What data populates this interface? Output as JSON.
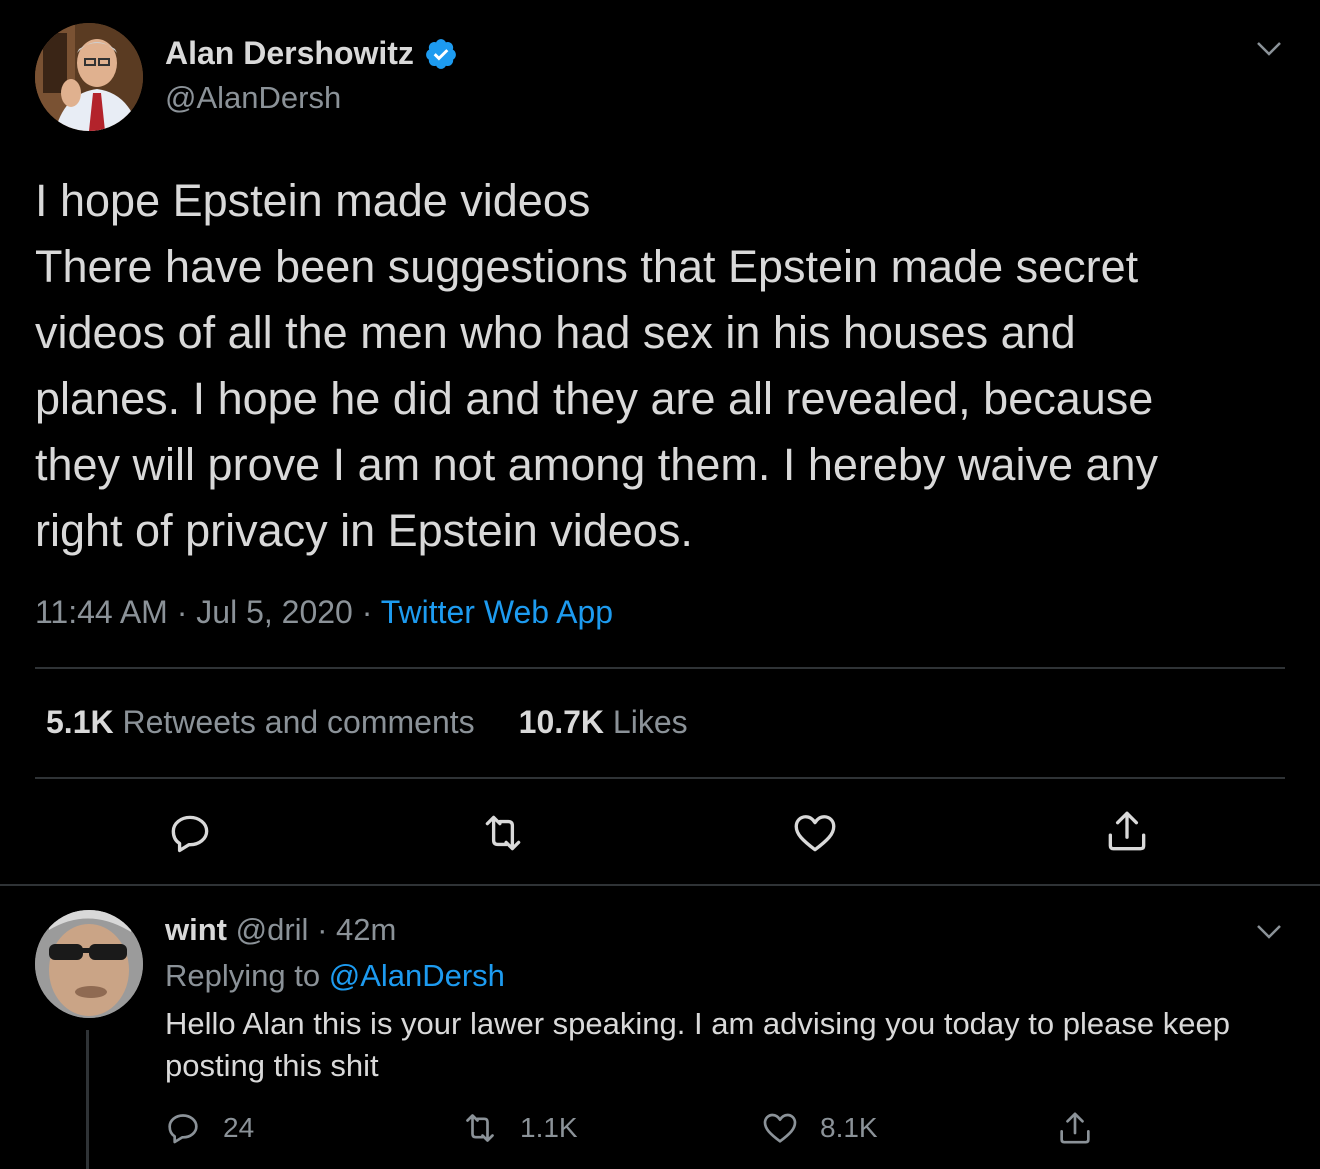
{
  "colors": {
    "background": "#000000",
    "text": "#d9d9d9",
    "muted": "#8b9298",
    "accent": "#1d9bf0",
    "divider": "#2f3336"
  },
  "tweet": {
    "display_name": "Alan Dershowitz",
    "handle": "@AlanDersh",
    "verified_icon": "verified-badge-icon",
    "text_lines": [
      "I hope Epstein made videos",
      "There have been suggestions that Epstein made secret",
      "videos of all the men who had sex in his houses and",
      "planes. I hope he did and they are all revealed, because",
      "they will prove I am not among them. I hereby waive any",
      "right of privacy in Epstein videos."
    ],
    "time": "11:44 AM",
    "date": "Jul 5, 2020",
    "separator": "·",
    "source": "Twitter Web App",
    "retweets_count": "5.1K",
    "retweets_label": "Retweets and comments",
    "likes_count": "10.7K",
    "likes_label": "Likes",
    "actions": [
      "reply-icon",
      "retweet-icon",
      "like-icon",
      "share-icon"
    ]
  },
  "reply": {
    "display_name": "wint",
    "handle": "@dril",
    "separator": "·",
    "time_ago": "42m",
    "replying_label": "Replying to",
    "replying_to": "@AlanDersh",
    "text": "Hello Alan this is your lawer speaking.  I am advising you today to please keep posting this shit",
    "reply_count": "24",
    "retweet_count": "1.1K",
    "like_count": "8.1K"
  }
}
